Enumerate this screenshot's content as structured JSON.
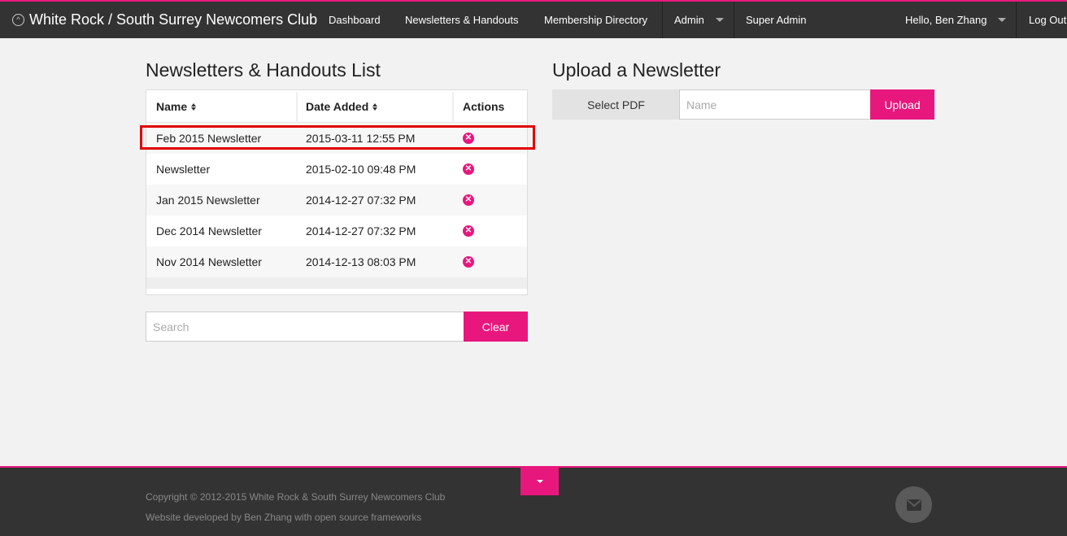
{
  "nav": {
    "brand": "White Rock / South Surrey Newcomers Club",
    "items": {
      "dashboard": "Dashboard",
      "newsletters": "Newsletters & Handouts",
      "directory": "Membership Directory",
      "admin": "Admin",
      "super_admin": "Super Admin",
      "greeting": "Hello, Ben Zhang",
      "logout": "Log Out"
    }
  },
  "list": {
    "title": "Newsletters & Handouts List",
    "columns": {
      "name": "Name",
      "date": "Date Added",
      "actions": "Actions"
    },
    "rows": [
      {
        "name": "Feb 2015 Newsletter",
        "date": "2015-03-11 12:55 PM"
      },
      {
        "name": "Newsletter",
        "date": "2015-02-10 09:48 PM"
      },
      {
        "name": "Jan 2015 Newsletter",
        "date": "2014-12-27 07:32 PM"
      },
      {
        "name": "Dec 2014 Newsletter",
        "date": "2014-12-27 07:32 PM"
      },
      {
        "name": "Nov 2014 Newsletter",
        "date": "2014-12-13 08:03 PM"
      }
    ],
    "search_placeholder": "Search",
    "clear_label": "Clear"
  },
  "upload": {
    "title": "Upload a Newsletter",
    "select_label": "Select PDF",
    "name_placeholder": "Name",
    "upload_label": "Upload"
  },
  "footer": {
    "copyright": "Copyright © 2012-2015 White Rock & South Surrey Newcomers Club",
    "credit": "Website developed by Ben Zhang with open source frameworks"
  },
  "colors": {
    "accent": "#e8177d",
    "nav_bg": "#333333",
    "highlight": "#e00000"
  }
}
